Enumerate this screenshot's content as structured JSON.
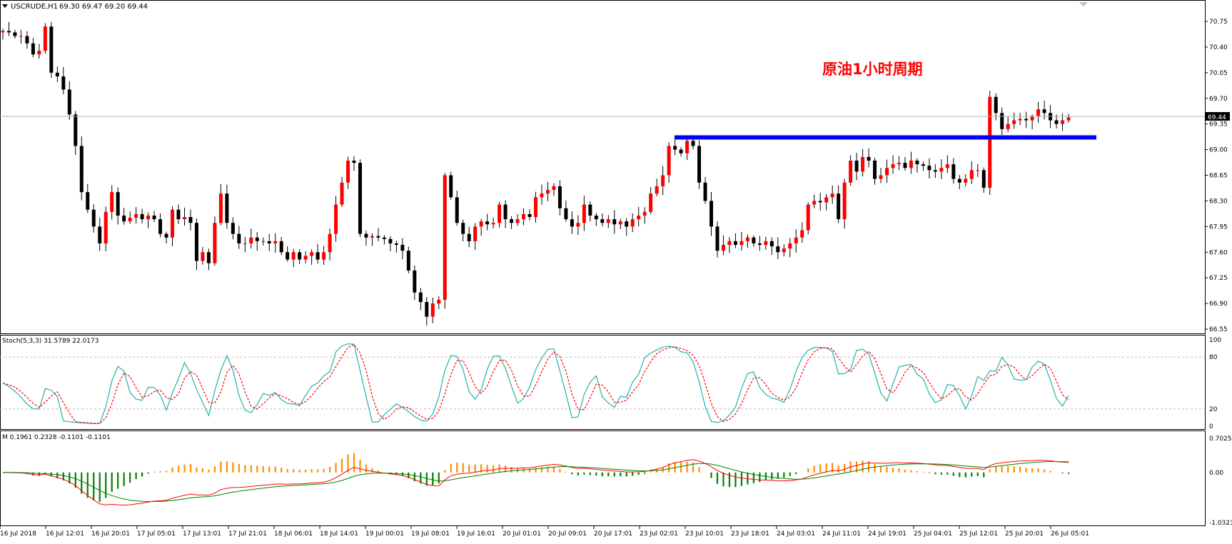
{
  "main": {
    "symbol_label": "USCRUDE,H1",
    "ohlc_label": "69.30 69.47 69.20 69.44",
    "annotation": "原油1小时周期",
    "current_price_label": "69.44"
  },
  "stoch_panel": {
    "label": "Stoch(5,3,3) 31.5789 22.0173",
    "levels": [
      "100",
      "80",
      "20",
      "0"
    ]
  },
  "macd_panel": {
    "label": "M 0.1961 0.2328 -0.1101 -0.1101",
    "levels": [
      "0.7025",
      "0.00",
      "-1.0323"
    ]
  },
  "colors": {
    "up_candle": "#ff0000",
    "down_candle": "#000000",
    "resistance_line": "#0000ff",
    "stoch_main": "#20b2aa",
    "stoch_signal": "#ff0000",
    "hist_positive": "#ff8c00",
    "hist_negative": "#008000",
    "macd_line": "#ff0000",
    "signal_line": "#008000"
  },
  "chart_data": {
    "type": "candlestick",
    "price_axis_labels": [
      "70.75",
      "70.40",
      "70.05",
      "69.70",
      "69.35",
      "69.00",
      "68.65",
      "68.30",
      "67.95",
      "67.60",
      "67.25",
      "66.90",
      "66.55"
    ],
    "x_tick_labels": [
      "16 Jul 2018",
      "16 Jul 12:01",
      "16 Jul 20:01",
      "17 Jul 05:01",
      "17 Jul 13:01",
      "17 Jul 21:01",
      "18 Jul 06:01",
      "18 Jul 14:01",
      "19 Jul 00:01",
      "19 Jul 08:01",
      "19 Jul 16:01",
      "20 Jul 01:01",
      "20 Jul 09:01",
      "20 Jul 17:01",
      "23 Jul 02:01",
      "23 Jul 10:01",
      "23 Jul 18:01",
      "24 Jul 03:01",
      "24 Jul 11:01",
      "24 Jul 19:01",
      "25 Jul 04:01",
      "25 Jul 12:01",
      "25 Jul 20:01",
      "26 Jul 05:01"
    ],
    "close_prices": [
      70.62,
      70.6,
      70.55,
      70.55,
      70.45,
      70.3,
      70.35,
      70.68,
      70.05,
      70.0,
      69.82,
      69.48,
      69.05,
      68.42,
      68.18,
      67.95,
      67.72,
      68.15,
      68.42,
      68.1,
      68.02,
      68.07,
      68.12,
      68.05,
      68.1,
      68.05,
      67.85,
      67.8,
      68.18,
      68.05,
      68.08,
      68.0,
      67.48,
      67.6,
      67.45,
      68.0,
      68.4,
      68.0,
      67.85,
      67.72,
      67.72,
      67.8,
      67.75,
      67.75,
      67.72,
      67.75,
      67.6,
      67.5,
      67.6,
      67.5,
      67.55,
      67.6,
      67.5,
      67.6,
      67.85,
      68.25,
      68.55,
      68.85,
      68.82,
      67.85,
      67.8,
      67.82,
      67.8,
      67.78,
      67.72,
      67.7,
      67.62,
      67.35,
      67.05,
      66.92,
      66.72,
      66.9,
      66.95,
      68.65,
      68.35,
      68.0,
      67.85,
      67.75,
      67.95,
      68.02,
      67.98,
      68.0,
      68.25,
      68.05,
      68.0,
      68.05,
      68.12,
      68.08,
      68.35,
      68.4,
      68.45,
      68.5,
      68.2,
      68.05,
      67.95,
      68.0,
      68.25,
      68.1,
      68.05,
      68.0,
      68.05,
      67.98,
      68.02,
      67.95,
      68.05,
      68.1,
      68.15,
      68.4,
      68.5,
      68.65,
      69.05,
      69.0,
      68.95,
      69.12,
      69.05,
      68.55,
      68.3,
      67.95,
      67.62,
      67.7,
      67.75,
      67.7,
      67.75,
      67.8,
      67.72,
      67.7,
      67.75,
      67.68,
      67.6,
      67.65,
      67.72,
      67.8,
      67.9,
      68.25,
      68.3,
      68.28,
      68.35,
      68.4,
      68.05,
      68.55,
      68.85,
      68.7,
      68.9,
      68.85,
      68.6,
      68.65,
      68.75,
      68.8,
      68.82,
      68.75,
      68.85,
      68.8,
      68.78,
      68.72,
      68.7,
      68.75,
      68.8,
      68.6,
      68.55,
      68.6,
      68.72,
      68.72,
      68.48,
      69.72,
      69.5,
      69.28,
      69.35,
      69.4,
      69.42,
      69.4,
      69.45,
      69.55,
      69.5,
      69.4,
      69.35,
      69.4,
      69.44
    ]
  }
}
